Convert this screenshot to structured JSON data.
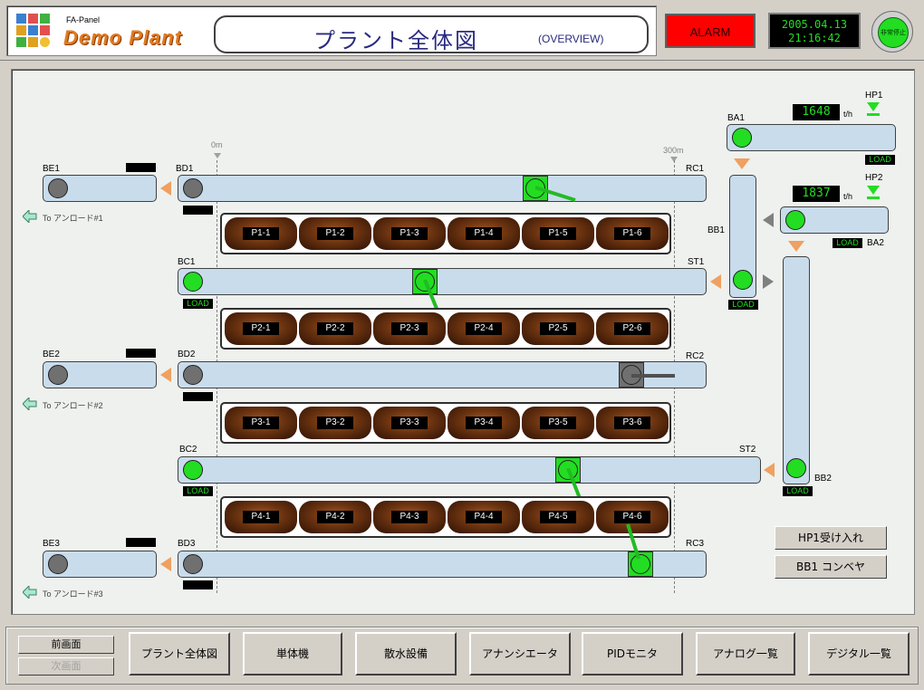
{
  "header": {
    "brand_small": "FA-Panel",
    "brand_big": "Demo Plant",
    "title": "プラント全体図",
    "subtitle": "(OVERVIEW)",
    "alarm_label": "ALARM",
    "date": "2005.04.13",
    "time": "21:16:42",
    "estop_label": "非常停止",
    "colors": {
      "alarm": "#ff0000",
      "running": "#22dd22",
      "stopped": "#707070",
      "brand": "#e07a20"
    }
  },
  "plant": {
    "scale": {
      "start": "0m",
      "end": "300m"
    },
    "to_unloader": [
      "To アンロード#1",
      "To アンロード#2",
      "To アンロード#3"
    ],
    "conveyors": {
      "BE1": "BE1",
      "BD1": "BD1",
      "RC1": "RC1",
      "BC1": "BC1",
      "ST1": "ST1",
      "BE2": "BE2",
      "BD2": "BD2",
      "RC2": "RC2",
      "BC2": "BC2",
      "ST2": "ST2",
      "BE3": "BE3",
      "BD3": "BD3",
      "RC3": "RC3",
      "BA1": "BA1",
      "BA2": "BA2",
      "BB1": "BB1",
      "BB2": "BB2",
      "HP1": "HP1",
      "HP2": "HP2"
    },
    "load_label": "LOAD",
    "flow": {
      "BA1": "1648",
      "BA2": "1837",
      "unit": "t/h"
    },
    "piles": [
      [
        "P1-1",
        "P1-2",
        "P1-3",
        "P1-4",
        "P1-5",
        "P1-6"
      ],
      [
        "P2-1",
        "P2-2",
        "P2-3",
        "P2-4",
        "P2-5",
        "P2-6"
      ],
      [
        "P3-1",
        "P3-2",
        "P3-3",
        "P3-4",
        "P3-5",
        "P3-6"
      ],
      [
        "P4-1",
        "P4-2",
        "P4-3",
        "P4-4",
        "P4-5",
        "P4-6"
      ]
    ],
    "side_buttons": [
      "HP1受け入れ",
      "BB1 コンベヤ"
    ]
  },
  "footer": {
    "prev": "前画面",
    "next": "次画面",
    "buttons": [
      "プラント全体図",
      "単体機",
      "散水設備",
      "アナンシエータ",
      "PIDモニタ",
      "アナログ一覧",
      "デジタル一覧"
    ]
  }
}
